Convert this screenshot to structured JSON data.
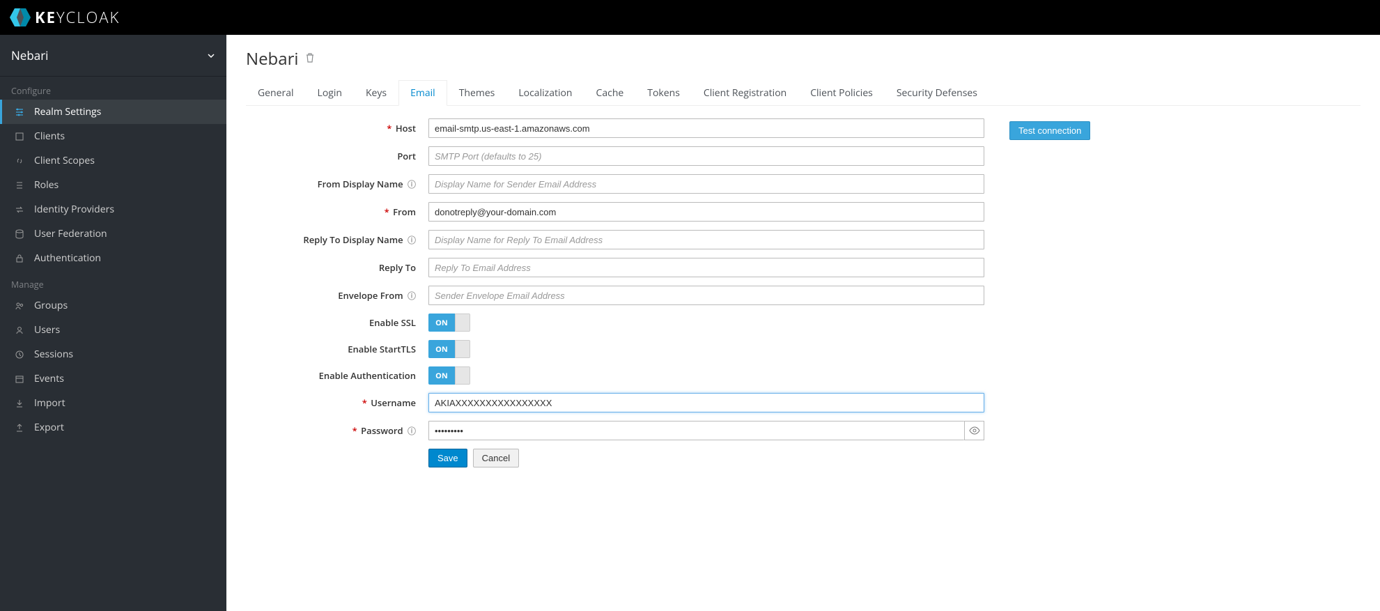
{
  "brand": {
    "name_a": "KE",
    "name_b": "YCLOAK"
  },
  "sidebar": {
    "realm_name": "Nebari",
    "section_configure": "Configure",
    "section_manage": "Manage",
    "configure_items": [
      {
        "label": "Realm Settings"
      },
      {
        "label": "Clients"
      },
      {
        "label": "Client Scopes"
      },
      {
        "label": "Roles"
      },
      {
        "label": "Identity Providers"
      },
      {
        "label": "User Federation"
      },
      {
        "label": "Authentication"
      }
    ],
    "manage_items": [
      {
        "label": "Groups"
      },
      {
        "label": "Users"
      },
      {
        "label": "Sessions"
      },
      {
        "label": "Events"
      },
      {
        "label": "Import"
      },
      {
        "label": "Export"
      }
    ]
  },
  "page": {
    "title": "Nebari",
    "tabs": [
      {
        "label": "General"
      },
      {
        "label": "Login"
      },
      {
        "label": "Keys"
      },
      {
        "label": "Email"
      },
      {
        "label": "Themes"
      },
      {
        "label": "Localization"
      },
      {
        "label": "Cache"
      },
      {
        "label": "Tokens"
      },
      {
        "label": "Client Registration"
      },
      {
        "label": "Client Policies"
      },
      {
        "label": "Security Defenses"
      }
    ],
    "active_tab": "Email"
  },
  "form": {
    "labels": {
      "host": "Host",
      "port": "Port",
      "from_display_name": "From Display Name",
      "from": "From",
      "reply_to_display_name": "Reply To Display Name",
      "reply_to": "Reply To",
      "envelope_from": "Envelope From",
      "enable_ssl": "Enable SSL",
      "enable_starttls": "Enable StartTLS",
      "enable_auth": "Enable Authentication",
      "username": "Username",
      "password": "Password"
    },
    "placeholders": {
      "port": "SMTP Port (defaults to 25)",
      "from_display_name": "Display Name for Sender Email Address",
      "reply_to_display_name": "Display Name for Reply To Email Address",
      "reply_to": "Reply To Email Address",
      "envelope_from": "Sender Envelope Email Address"
    },
    "values": {
      "host": "email-smtp.us-east-1.amazonaws.com",
      "port": "",
      "from_display_name": "",
      "from": "donotreply@your-domain.com",
      "reply_to_display_name": "",
      "reply_to": "",
      "envelope_from": "",
      "username": "AKIAXXXXXXXXXXXXXXXX",
      "password": "•••••••••"
    },
    "toggles": {
      "enable_ssl": "ON",
      "enable_starttls": "ON",
      "enable_auth": "ON"
    }
  },
  "buttons": {
    "test_connection": "Test connection",
    "save": "Save",
    "cancel": "Cancel"
  }
}
